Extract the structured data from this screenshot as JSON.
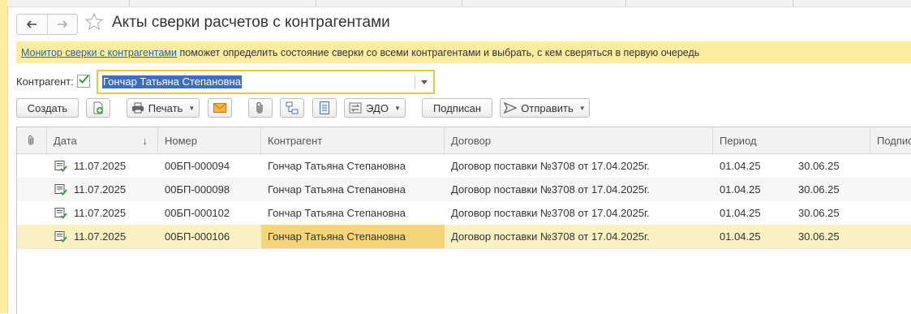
{
  "window": {
    "title": "Акты сверки расчетов с контрагентами",
    "nav": {
      "back_icon": "arrow-left-icon",
      "forward_icon": "arrow-right-icon"
    },
    "favorite_icon": "star-icon"
  },
  "info_bar": {
    "link_text": "Монитор сверки с контрагентами",
    "text": " поможет определить состояние сверки со всеми контрагентами и выбрать, с кем сверяться в первую очередь"
  },
  "filter": {
    "label": "Контрагент:",
    "checked": true,
    "value": "Гончар Татьяна Степановна"
  },
  "toolbar": {
    "create_label": "Создать",
    "print_label": "Печать",
    "edo_label": "ЭДО",
    "signed_label": "Подписан",
    "send_label": "Отправить"
  },
  "table": {
    "columns": {
      "date": "Дата",
      "sort_indicator": "↓",
      "number": "Номер",
      "counterparty": "Контрагент",
      "contract": "Договор",
      "period": "Период",
      "signed": "Подпис"
    },
    "rows": [
      {
        "date": "11.07.2025",
        "number": "00БП-000094",
        "counterparty": "Гончар Татьяна Степановна",
        "contract": "Договор поставки №3708 от 17.04.2025г.",
        "period_from": "01.04.25",
        "period_to": "30.06.25"
      },
      {
        "date": "11.07.2025",
        "number": "00БП-000098",
        "counterparty": "Гончар Татьяна Степановна",
        "contract": "Договор поставки №3708 от 17.04.2025г.",
        "period_from": "01.04.25",
        "period_to": "30.06.25"
      },
      {
        "date": "11.07.2025",
        "number": "00БП-000102",
        "counterparty": "Гончар Татьяна Степановна",
        "contract": "Договор поставки №3708 от 17.04.2025г.",
        "period_from": "01.04.25",
        "period_to": "30.06.25"
      },
      {
        "date": "11.07.2025",
        "number": "00БП-000106",
        "counterparty": "Гончар Татьяна Степановна",
        "contract": "Договор поставки №3708 от 17.04.2025г.",
        "period_from": "01.04.25",
        "period_to": "30.06.25"
      }
    ]
  },
  "colors": {
    "accent_yellow": "#fbeca0",
    "selection_blue": "#3d6dbf",
    "link_blue": "#2a5fb0",
    "check_green": "#2e9b3a",
    "focused_cell": "#f5d57a"
  }
}
